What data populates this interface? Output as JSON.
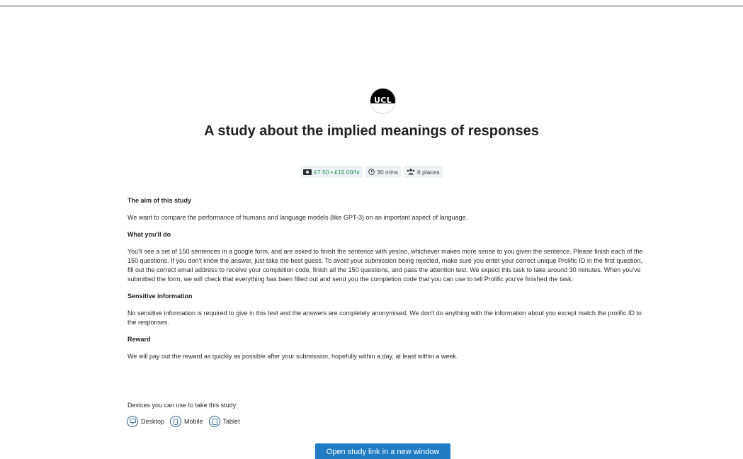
{
  "logo": {
    "text": "UCL"
  },
  "study": {
    "title": "A study about the implied meanings of responses",
    "reward": "£7.50 • £15.00/hr",
    "duration": "30 mins",
    "places": "6 places"
  },
  "sections": [
    {
      "heading": "The aim of this study",
      "body": "We want to compare the performance of humans and language models (like GPT-3) on an important aspect of language."
    },
    {
      "heading": "What you'll do",
      "body": "You'll see a set of 150 sentences in a google form, and are asked to finish the sentence with yes/no, whichever makes more sense to you given the sentence. Please finish each of the 150 questions. If you don't know the answer, just take the best guess. To avoid your submission being rejected, make sure you enter your correct unique Prolific ID in the first question, fill out the correct email address to receive your completion code, finish all the 150 questions, and pass the attention test. We expect this task to take around 30 minutes. When you've submitted the form, we will check that everything has been filled out and send you the completion code that you can use to tell Prolific you've finished the task."
    },
    {
      "heading": "Sensitive information",
      "body": "No sensitive information is required to give in this test and the answers are completely anonymised. We don't do anything with the information about you except match the prolific ID to the responses."
    },
    {
      "heading": "Reward",
      "body": "We will pay out the reward as quickly as possible after your submission, hopefully within a day, at least within a week."
    }
  ],
  "devices": {
    "label": "Devices you can use to take this study:",
    "items": [
      {
        "name": "Desktop",
        "icon": "desktop-icon"
      },
      {
        "name": "Mobile",
        "icon": "mobile-icon"
      },
      {
        "name": "Tablet",
        "icon": "tablet-icon"
      }
    ]
  },
  "cta": {
    "label": "Open study link in a new window"
  },
  "colors": {
    "accent": "#1f7bc4",
    "reward_green": "#1b8a5a",
    "badge_bg": "#eef2f4"
  }
}
